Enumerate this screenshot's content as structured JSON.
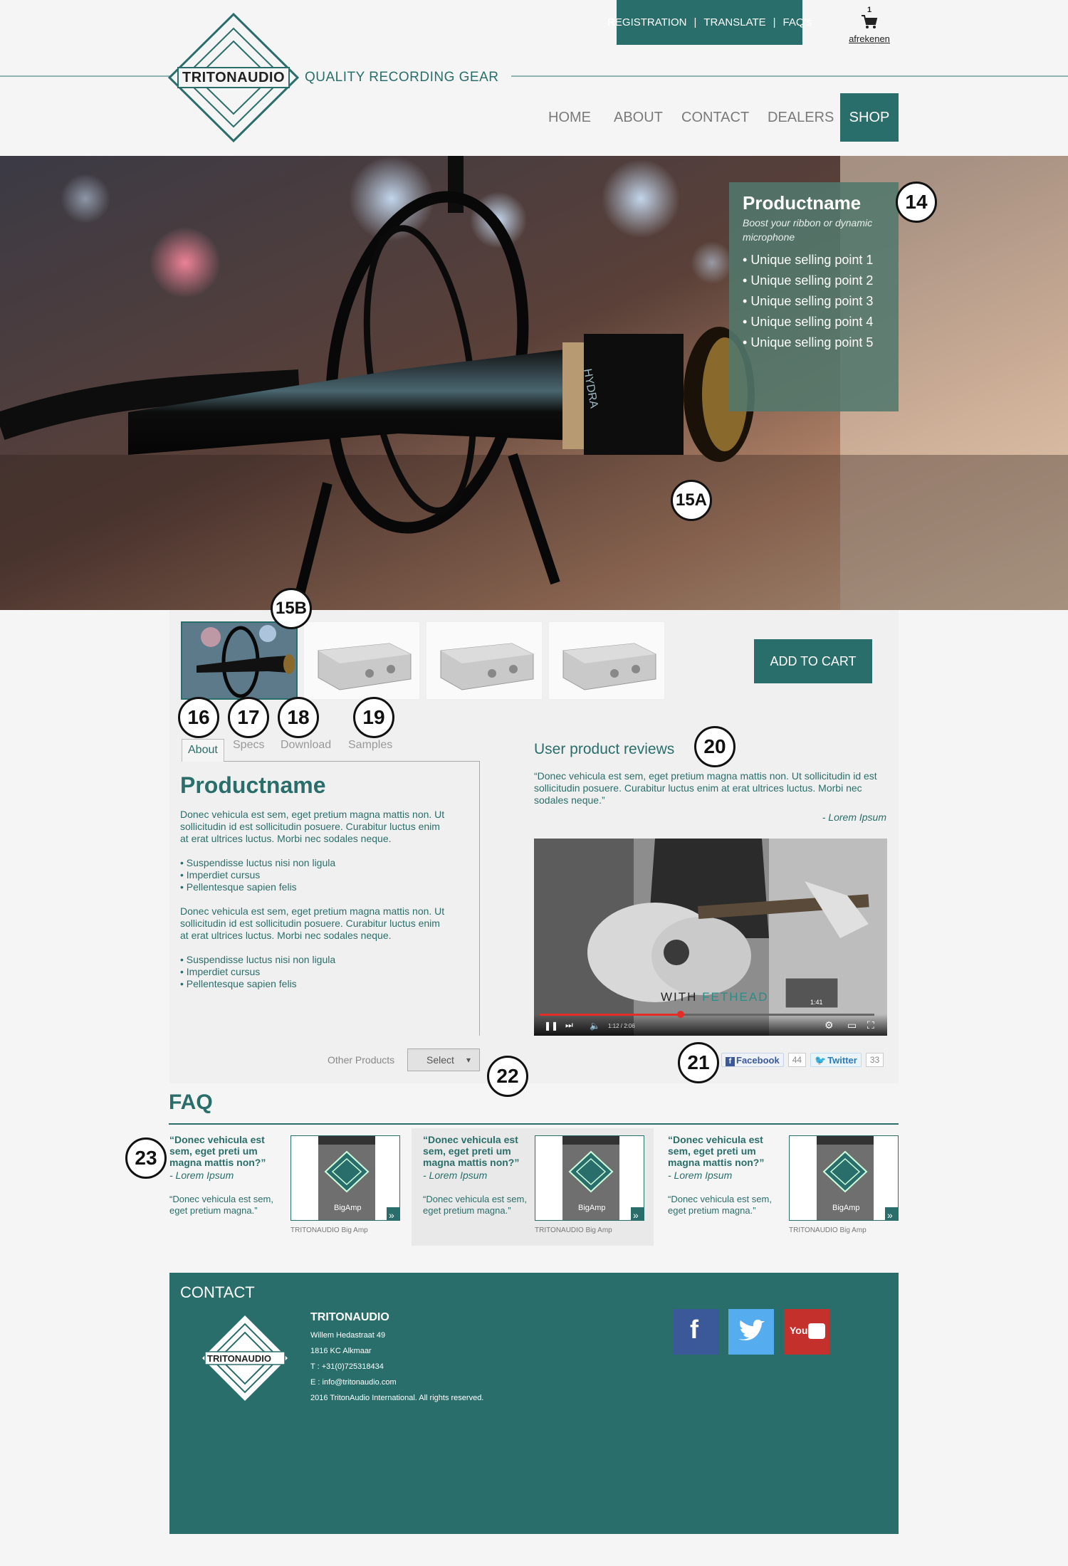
{
  "header": {
    "topbar": [
      "REGISTRATION",
      "TRANSLATE",
      "FAQ's"
    ],
    "cart_count": "1",
    "cart_label": "afrekenen",
    "logo_text": "TRITONAUDIO",
    "tagline": "QUALITY RECORDING GEAR",
    "nav": [
      "HOME",
      "ABOUT",
      "CONTACT",
      "DEALERS",
      "SHOP"
    ]
  },
  "hero": {
    "title": "Productname",
    "subtitle": "Boost your ribbon or dynamic microphone",
    "usps": [
      "Unique selling point 1",
      "Unique selling point 2",
      "Unique selling point 3",
      "Unique selling point 4",
      "Unique selling point 5"
    ],
    "mic_label": "HYDRA"
  },
  "markers": [
    "14",
    "15A",
    "15B",
    "16",
    "17",
    "18",
    "19",
    "20",
    "21",
    "22",
    "23"
  ],
  "product": {
    "add_to_cart": "ADD TO CART",
    "tabs": [
      "About",
      "Specs",
      "Download",
      "Samples"
    ],
    "title": "Productname",
    "para1": "Donec vehicula est sem, eget pretium magna mattis non. Ut sollicitudin id est sollicitudin posuere. Curabitur luctus enim at erat ultrices luctus. Morbi nec sodales neque.",
    "list1": [
      "Suspendisse luctus nisi non ligula",
      "Imperdiet cursus",
      "Pellentesque sapien felis"
    ],
    "para2": "Donec vehicula est sem, eget pretium magna mattis non. Ut sollicitudin id est sollicitudin posuere. Curabitur luctus enim at erat ultrices luctus. Morbi nec sodales neque.",
    "list2": [
      "Suspendisse luctus nisi non ligula",
      "Imperdiet cursus",
      "Pellentesque sapien felis"
    ],
    "other_products_label": "Other Products",
    "select_label": "Select"
  },
  "reviews": {
    "title": "User product reviews",
    "text": "“Donec vehicula est sem, eget pretium magna mattis non. Ut sollicitudin id est sollicitudin posuere. Curabitur luctus enim at erat ultrices luctus. Morbi nec sodales neque.”",
    "author": "- Lorem Ipsum",
    "video_with": "WITH",
    "video_brand": "FETHEAD",
    "video_time": "1:12 / 2:06",
    "thumb_time": "1:41",
    "facebook_label": "Facebook",
    "facebook_count": "44",
    "twitter_label": "Twitter",
    "twitter_count": "33"
  },
  "faq": {
    "title": "FAQ",
    "items": [
      {
        "q": "“Donec vehicula est sem, eget preti um magna mattis non?”",
        "a": "- Lorem Ipsum",
        "p": "“Donec vehicula est sem, eget pretium magna.”",
        "caption": "TRITONAUDIO Big Amp",
        "img_label": "BigAmp"
      },
      {
        "q": "“Donec vehicula est sem, eget preti um magna mattis non?”",
        "a": "- Lorem Ipsum",
        "p": "“Donec vehicula est sem, eget pretium magna.”",
        "caption": "TRITONAUDIO Big Amp",
        "img_label": "BigAmp"
      },
      {
        "q": "“Donec vehicula est sem, eget preti um magna mattis non?”",
        "a": "- Lorem Ipsum",
        "p": "“Donec vehicula est sem, eget pretium magna.”",
        "caption": "TRITONAUDIO Big Amp",
        "img_label": "BigAmp"
      }
    ]
  },
  "footer": {
    "title": "CONTACT",
    "company": "TRITONAUDIO",
    "lines": [
      "Willem Hedastraat 49",
      "1816 KC Alkmaar",
      "T : +31(0)725318434",
      "E : info@tritonaudio.com",
      "2016 TritonAudio International. All rights reserved."
    ],
    "youtube_label": "You"
  },
  "colors": {
    "brand": "#2a6e6b",
    "facebook": "#3b5998",
    "twitter": "#55acee",
    "youtube": "#c4302b"
  }
}
